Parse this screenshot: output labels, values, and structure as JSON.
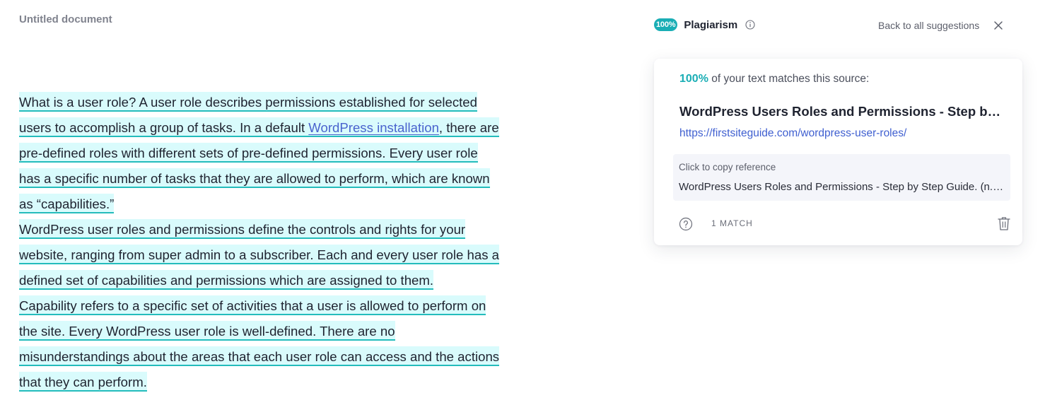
{
  "document": {
    "title": "Untitled document",
    "paragraphs": [
      {
        "before_link": "What is a user role? A user role describes permissions established for selected users to accomplish a group of tasks. In a default ",
        "link_text": "WordPress installation",
        "after_link": ", there are pre-defined roles with different sets of pre-defined permissions. Every user role has a specific number of tasks that they are allowed to perform, which are known as “capabilities.”"
      },
      {
        "text": "WordPress user roles and permissions define the controls and rights for your website, ranging from super admin to a subscriber. Each and every user role has a defined set of capabilities and permissions which are assigned to them."
      },
      {
        "text": "Capability refers to a specific set of activities that a user is allowed to perform on the site. Every WordPress user role is well-defined. There are no misunderstandings about the areas that each user role can access and the actions that they can perform."
      }
    ],
    "highlight_colors": {
      "background": "#d9fbfc",
      "underline": "#24bcbc",
      "link": "#4a63ce"
    }
  },
  "panel": {
    "score_badge": "100%",
    "title": "Plagiarism",
    "back_link": "Back to all suggestions",
    "accent_color": "#1aaeb5",
    "card": {
      "match_percent": "100%",
      "match_text": " of your text matches this source:",
      "source_title": "WordPress Users Roles and Permissions - Step by Step Guide",
      "source_url": "https://firstsiteguide.com/wordpress-user-roles/",
      "reference_label": "Click to copy reference",
      "reference_text": "WordPress Users Roles and Permissions - Step by Step Guide. (n.d.). Retrieved from https://firstsiteguide.com/wordpress-user-roles/",
      "match_count": "1 MATCH"
    },
    "icons": [
      "info-icon",
      "close-icon",
      "help-icon",
      "trash-icon"
    ]
  }
}
